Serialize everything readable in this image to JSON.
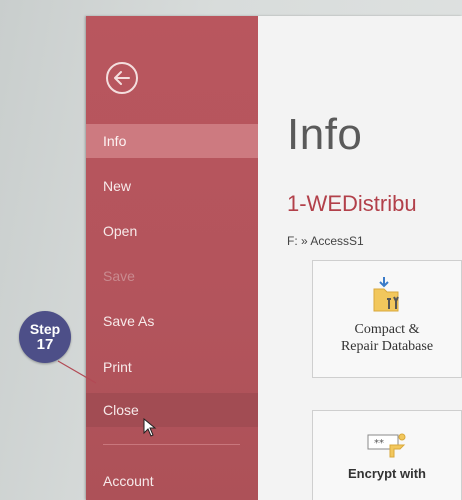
{
  "nav": {
    "items": [
      {
        "label": "Info",
        "state": "active"
      },
      {
        "label": "New",
        "state": "normal"
      },
      {
        "label": "Open",
        "state": "normal"
      },
      {
        "label": "Save",
        "state": "disabled"
      },
      {
        "label": "Save As",
        "state": "normal"
      },
      {
        "label": "Print",
        "state": "normal"
      },
      {
        "label": "Close",
        "state": "hover"
      },
      {
        "label": "Account",
        "state": "normal"
      }
    ]
  },
  "main": {
    "title": "Info",
    "file_name": "1-WEDistribu",
    "file_path": "F: » AccessS1",
    "cards": {
      "compact": {
        "label_line1": "Compact &",
        "label_line2": "Repair Database"
      },
      "encrypt": {
        "label_line1": "Encrypt with"
      }
    }
  },
  "callout": {
    "step_word": "Step",
    "step_number": "17"
  },
  "colors": {
    "backstage": "#b3545c",
    "nav_active": "#cd7a80",
    "file_name": "#b2404a",
    "step_badge": "#4d4f88"
  },
  "icons": {
    "back": "back-arrow-icon",
    "compact": "compact-repair-icon",
    "encrypt": "encrypt-password-icon",
    "cursor": "mouse-pointer-icon"
  }
}
